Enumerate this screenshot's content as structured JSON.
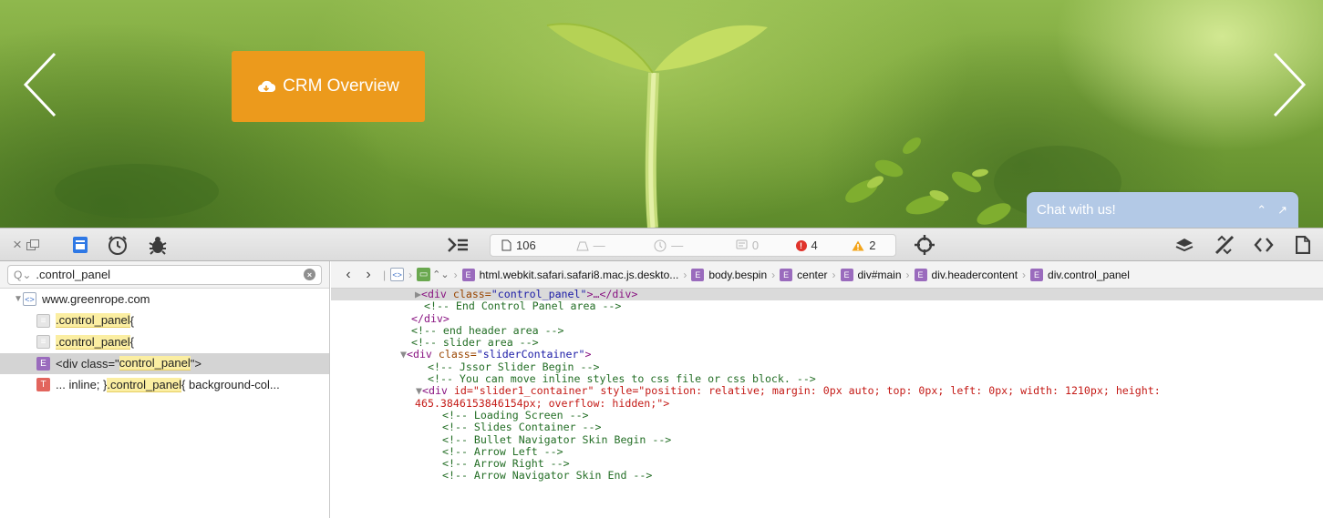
{
  "hero": {
    "cta_label": "CRM Overview",
    "chat_title": "Chat with us!",
    "accent_color": "#ec9a1c"
  },
  "toolbar": {
    "documents_count": "106",
    "load_time": "—",
    "time": "—",
    "logs_count": "0",
    "errors_count": "4",
    "warnings_count": "2"
  },
  "search": {
    "value": ".control_panel"
  },
  "results": {
    "domain": "www.greenrope.com",
    "items": [
      {
        "badge": "css",
        "prefix": "",
        "match": ".control_panel",
        "suffix": " {"
      },
      {
        "badge": "css",
        "prefix": "",
        "match": ".control_panel",
        "suffix": " {"
      },
      {
        "badge": "E",
        "prefix": "<div class=\"",
        "match": "control_panel",
        "suffix": "\">"
      },
      {
        "badge": "T",
        "prefix": "... inline; } ",
        "match": ".control_panel",
        "suffix": " { background-col..."
      }
    ]
  },
  "breadcrumbs": [
    "html.webkit.safari.safari8.mac.js.deskto...",
    "body.bespin",
    "center",
    "div#main",
    "div.headercontent",
    "div.control_panel"
  ],
  "code": {
    "l1_tag": "<div ",
    "l1_attr": "class=",
    "l1_val": "\"control_panel\"",
    "l1_rest": ">…</div>",
    "l2": "<!-- End Control Panel area -->",
    "l3": "</div>",
    "l4": "<!-- end header area -->",
    "l5": "<!-- slider area -->",
    "l6_tag": "<div ",
    "l6_attr": "class=",
    "l6_val": "\"sliderContainer\"",
    "l6_end": ">",
    "l7": "<!-- Jssor Slider Begin -->",
    "l8": "<!-- You can move inline styles to css file or css block. -->",
    "l9_tag": "<div ",
    "l9_text": "id=\"slider1_container\" style=\"position: relative; margin: 0px auto; top: 0px; left: 0px; width: 1210px; height:",
    "l10_text": "465.3846153846154px; overflow: hidden;\">",
    "l11": "<!-- Loading Screen -->",
    "l12": "<!-- Slides Container -->",
    "l13": "<!-- Bullet Navigator Skin Begin -->",
    "l14": "<!-- Arrow Left -->",
    "l15": "<!-- Arrow Right -->",
    "l16": "<!-- Arrow Navigator Skin End -->"
  }
}
